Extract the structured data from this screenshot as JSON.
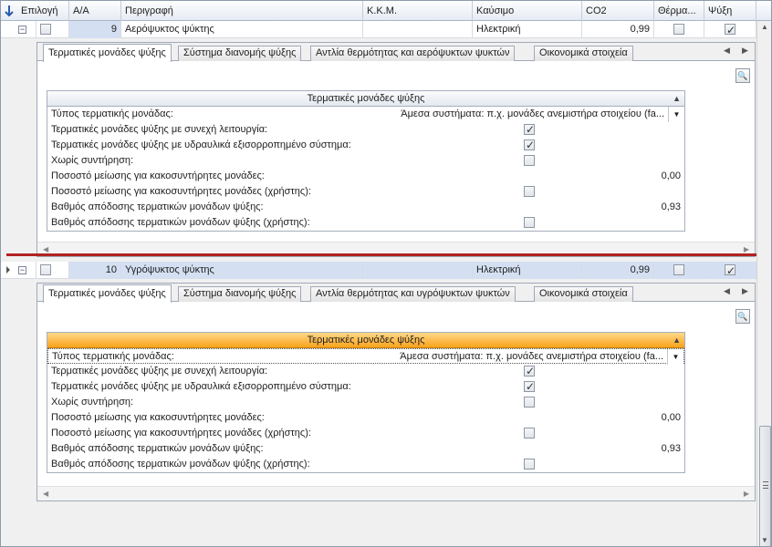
{
  "columns": [
    {
      "key": "epilogi",
      "label": "Επιλογή"
    },
    {
      "key": "aa",
      "label": "Α/Α"
    },
    {
      "key": "perigrafi",
      "label": "Περιγραφή"
    },
    {
      "key": "kkm",
      "label": "Κ.Κ.Μ."
    },
    {
      "key": "kafsimo",
      "label": "Καύσιμο"
    },
    {
      "key": "co2",
      "label": "CO2"
    },
    {
      "key": "therm",
      "label": "Θέρμα..."
    },
    {
      "key": "psyxi",
      "label": "Ψύξη"
    }
  ],
  "rows": [
    {
      "aa": "9",
      "perigrafi": "Αερόψυκτος ψύκτης",
      "kkm": "",
      "kafsimo": "Ηλεκτρική",
      "co2": "0,99",
      "epilogi_checked": false,
      "therm_checked": false,
      "psyxi_checked": true,
      "tabs": [
        "Τερματικές μονάδες ψύξης",
        "Σύστημα διανομής ψύξης",
        "Αντλία θερμότητας και αερόψυκτων ψυκτών",
        "Οικονομικά στοιχεία"
      ],
      "section_title": "Τερματικές μονάδες ψύξης",
      "props": [
        {
          "label": "Τύπος τερματικής μονάδας:",
          "value": "Άμεσα συστήματα: π.χ. μονάδες ανεμιστήρα στοιχείου (fa...",
          "type": "dropdown"
        },
        {
          "label": "Τερματικές μονάδες ψύξης με συνεχή λειτουργία:",
          "type": "check",
          "checked": true
        },
        {
          "label": "Τερματικές μονάδες ψύξης με υδραυλικά εξισορροπημένο σύστημα:",
          "type": "check",
          "checked": true
        },
        {
          "label": "Χωρίς συντήρηση:",
          "type": "check",
          "checked": false
        },
        {
          "label": "Ποσοστό μείωσης για κακοσυντήρητες μονάδες:",
          "value": "0,00",
          "type": "number"
        },
        {
          "label": "Ποσοστό μείωσης για κακοσυντήρητες μονάδες (χρήστης):",
          "type": "check",
          "checked": false
        },
        {
          "label": "Βαθμός απόδοσης τερματικών μονάδων ψύξης:",
          "value": "0,93",
          "type": "number"
        },
        {
          "label": "Βαθμός απόδοσης τερματικών μονάδων ψύξης (χρήστης):",
          "type": "check",
          "checked": false
        }
      ]
    },
    {
      "aa": "10",
      "perigrafi": "Υγρόψυκτος ψύκτης",
      "kkm": "",
      "kafsimo": "Ηλεκτρική",
      "co2": "0,99",
      "epilogi_checked": false,
      "therm_checked": false,
      "psyxi_checked": true,
      "tabs": [
        "Τερματικές μονάδες ψύξης",
        "Σύστημα διανομής ψύξης",
        "Αντλία θερμότητας και υγρόψυκτων ψυκτών",
        "Οικονομικά στοιχεία"
      ],
      "section_title": "Τερματικές μονάδες ψύξης",
      "props": [
        {
          "label": "Τύπος τερματικής μονάδας:",
          "value": "Άμεσα συστήματα: π.χ. μονάδες ανεμιστήρα στοιχείου (fa...",
          "type": "dropdown"
        },
        {
          "label": "Τερματικές μονάδες ψύξης με συνεχή λειτουργία:",
          "type": "check",
          "checked": true
        },
        {
          "label": "Τερματικές μονάδες ψύξης με υδραυλικά εξισορροπημένο σύστημα:",
          "type": "check",
          "checked": true
        },
        {
          "label": "Χωρίς συντήρηση:",
          "type": "check",
          "checked": false
        },
        {
          "label": "Ποσοστό μείωσης για κακοσυντήρητες μονάδες:",
          "value": "0,00",
          "type": "number"
        },
        {
          "label": "Ποσοστό μείωσης για κακοσυντήρητες μονάδες (χρήστης):",
          "type": "check",
          "checked": false
        },
        {
          "label": "Βαθμός απόδοσης τερματικών μονάδων ψύξης:",
          "value": "0,93",
          "type": "number"
        },
        {
          "label": "Βαθμός απόδοσης τερματικών μονάδων ψύξης (χρήστης):",
          "type": "check",
          "checked": false
        }
      ]
    }
  ],
  "colors": {
    "accent_separator": "#b22222",
    "active_header": "#f9a31a"
  }
}
